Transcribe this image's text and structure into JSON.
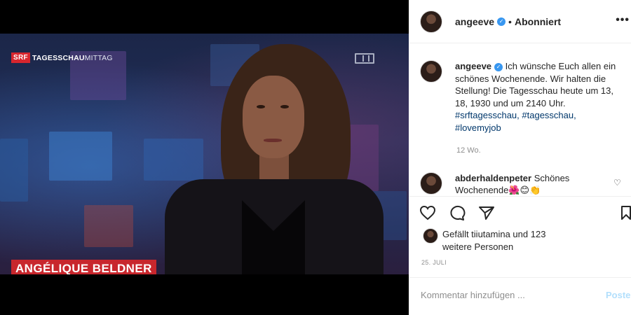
{
  "media": {
    "logo_brand": "SRF",
    "logo_title": "TAGESSCHAU",
    "logo_subtitle": "MITTAG",
    "name_caption": "ANGÉLIQUE BELDNER"
  },
  "header": {
    "username": "angeeve",
    "separator": "•",
    "follow_status": "Abonniert",
    "more_icon": "more-horizontal-icon"
  },
  "caption": {
    "username": "angeeve",
    "text": " Ich wünsche Euch allen ein schönes Wochenende. Wir halten die Stellung! Die Tagesschau heute um 13, 18, 1930 und um 2140 Uhr. ",
    "hashtags": "#srftagesschau, #tagesschau, #lovemyjob",
    "age": "12 Wo."
  },
  "comment": {
    "username": "abderhaldenpeter",
    "text": " Schönes Wochenende🌺😊👏"
  },
  "actions": {
    "like_icon": "heart-icon",
    "comment_icon": "comment-icon",
    "share_icon": "send-icon",
    "save_icon": "bookmark-icon"
  },
  "likes": {
    "text": "Gefällt tiiutamina und 123 weitere Personen"
  },
  "date": "25. JULI",
  "comment_bar": {
    "placeholder": "Kommentar hinzufügen ...",
    "post_label": "Posten"
  },
  "colors": {
    "accent": "#3897f0",
    "srf_red": "#d7262e",
    "hashtag": "#00376b"
  }
}
